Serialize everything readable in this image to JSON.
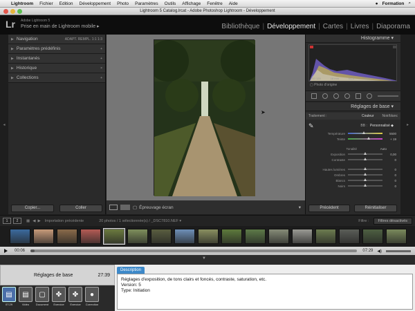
{
  "menubar": {
    "apple": "",
    "app": "Lightroom",
    "items": [
      "Fichier",
      "Edition",
      "Développement",
      "Photo",
      "Paramètres",
      "Outils",
      "Affichage",
      "Fenêtre",
      "Aide"
    ],
    "right_user": "Formation"
  },
  "window": {
    "title": "Lightroom 5 Catalog.lrcat - Adobe Photoshop Lightroom - Développement"
  },
  "identity": {
    "logo": "Lr",
    "product": "Adobe Lightroom 5",
    "tagline": "Prise en main de Lightroom mobile",
    "arrow": "▸"
  },
  "modules": [
    "Bibliothèque",
    "Développement",
    "Cartes",
    "Livres",
    "Diaporama"
  ],
  "active_module": "Développement",
  "left_panel": {
    "items": [
      {
        "label": "Navigation",
        "extra": "ADAPT.  REMPL.  1:1  1:3"
      },
      {
        "label": "Paramètres prédéfinis",
        "extra": "+"
      },
      {
        "label": "Instantanés",
        "extra": "+"
      },
      {
        "label": "Historique",
        "extra": "×"
      },
      {
        "label": "Collections",
        "extra": "+"
      }
    ],
    "copy_btn": "Copier...",
    "paste_btn": "Coller"
  },
  "toolbar": {
    "softproof": "Épreuvage écran"
  },
  "right_panel": {
    "histogram_title": "Histogramme",
    "hist_info": [
      "ISO 120",
      "18 mm",
      "f/4,5",
      "1/25 s"
    ],
    "photo_orig": "Photo d'origine",
    "basic_title": "Réglages de base",
    "treatment_label": "Traitement :",
    "treatment_color": "Couleur",
    "treatment_bw": "Noir/blanc",
    "wb_label": "BB :",
    "wb_value": "Personnalisé",
    "sliders": [
      {
        "label": "Température",
        "value": "5500",
        "style": "grad",
        "pos": 0.46
      },
      {
        "label": "Teinte",
        "value": "+ 19",
        "style": "grad2",
        "pos": 0.6
      },
      {
        "label": "Tonalité",
        "value": "Auto",
        "style": "head"
      },
      {
        "label": "Exposition",
        "value": "0,00",
        "style": "plain",
        "pos": 0.5
      },
      {
        "label": "Contraste",
        "value": "0",
        "style": "plain",
        "pos": 0.5
      },
      {
        "label": "Hautes lumières",
        "value": "0",
        "style": "plain",
        "pos": 0.5
      },
      {
        "label": "Ombres",
        "value": "0",
        "style": "plain",
        "pos": 0.5
      },
      {
        "label": "Blancs",
        "value": "0",
        "style": "plain",
        "pos": 0.5
      },
      {
        "label": "Noirs",
        "value": "0",
        "style": "plain",
        "pos": 0.5
      }
    ],
    "prev_btn": "Précédent",
    "reset_btn": "Réinitialiser"
  },
  "filmstrip_bar": {
    "page1": "1",
    "page2": "2",
    "source": "Importation précédente",
    "count": "20 photos / 1 sélectionnée(s) / _DSC7810.NEF ▾",
    "filter_label": "Filtre :",
    "filter_value": "Filtres désactivés"
  },
  "thumb_colors": [
    "#3b6a9e",
    "#c89b7a",
    "#8a6a4a",
    "#b45b55",
    "#6b7a3f",
    "#7e8f5c",
    "#5a5e40",
    "#6e90b8",
    "#8a9060",
    "#5e7a3c",
    "#5d7a48",
    "#868c78",
    "#9a9a94",
    "#6c7c50",
    "#5b5e58",
    "#4e6042",
    "#7a8a5c",
    "#787868",
    "#8c8a80",
    "#9a4c48"
  ],
  "selected_thumb": 4,
  "video": {
    "current": "00:06",
    "total": "07:29",
    "progress": 0.013
  },
  "lesson": {
    "title": "Réglages de base",
    "duration": "27:39"
  },
  "icons": [
    {
      "name": "Vidéo",
      "time": "07:29",
      "glyph": "▤",
      "active": true
    },
    {
      "name": "Vidéo",
      "time": "",
      "glyph": "▤",
      "active": false
    },
    {
      "name": "Document",
      "time": "",
      "glyph": "▢",
      "active": false
    },
    {
      "name": "Exercice",
      "time": "",
      "glyph": "✤",
      "active": false
    },
    {
      "name": "Exercice",
      "time": "",
      "glyph": "✤",
      "active": false
    },
    {
      "name": "Correction",
      "time": "",
      "glyph": "●",
      "active": false
    }
  ],
  "description": {
    "tab": "Description",
    "lines": [
      "Réglages d'exposition, de tons clairs et foncés, contraste, saturation, etc.",
      "Version: 5",
      "Type: Initiation"
    ]
  }
}
